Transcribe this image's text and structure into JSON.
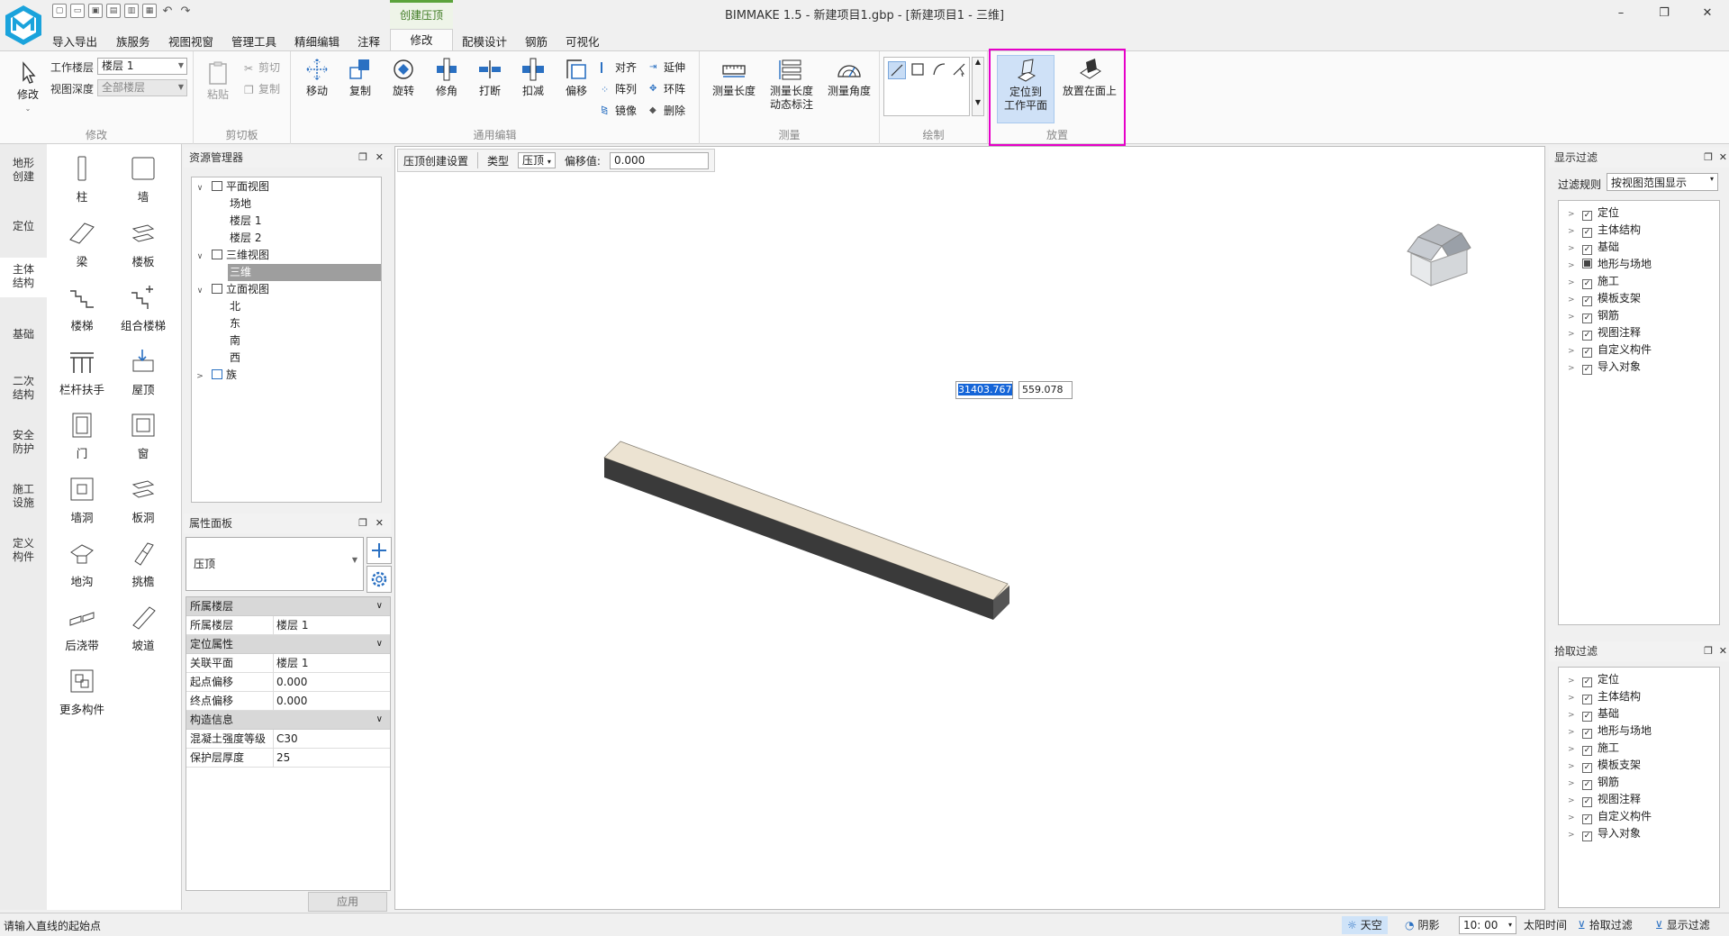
{
  "app": {
    "window_title": "BIMMAKE 1.5 - 新建项目1.gbp - [新建项目1 - 三维]",
    "context_tab": "创建压顶",
    "menu_tabs": [
      "导入导出",
      "族服务",
      "视图视窗",
      "管理工具",
      "精细编辑",
      "注释",
      "修改",
      "配模设计",
      "钢筋",
      "可视化"
    ],
    "win_min": "–",
    "win_restore": "❐",
    "win_close": "✕",
    "help": "?",
    "doc_min": "–",
    "doc_restore": "❐",
    "doc_close": "✕"
  },
  "ribbon": {
    "modify": {
      "label": "修改",
      "button": "修改",
      "floor_label": "工作楼层",
      "floor_value": "楼层 1",
      "depth_label": "视图深度",
      "depth_value": "全部楼层"
    },
    "clipboard": {
      "label": "剪切板",
      "paste": "粘贴",
      "cut": "剪切",
      "copy": "复制"
    },
    "edit": {
      "label": "通用编辑",
      "move": "移动",
      "copy": "复制",
      "rotate": "旋转",
      "trim": "修角",
      "break": "打断",
      "deduct": "扣减",
      "offset": "偏移",
      "align": "对齐",
      "array": "阵列",
      "mirror": "镜像",
      "extend": "延伸",
      "ring_array": "环阵",
      "delete": "删除"
    },
    "measure": {
      "label": "测量",
      "length": "测量长度",
      "dim_line1": "测量长度",
      "dim_line2": "动态标注",
      "angle": "测量角度"
    },
    "draw": {
      "label": "绘制"
    },
    "place": {
      "label": "放置",
      "on_plane_line1": "定位到",
      "on_plane_line2": "工作平面",
      "on_face": "放置在面上"
    }
  },
  "categories": [
    "地形创建",
    "定位",
    "主体结构",
    "基础",
    "二次结构",
    "安全防护",
    "施工设施",
    "定义构件"
  ],
  "active_category": "主体结构",
  "components": [
    "柱",
    "墙",
    "梁",
    "楼板",
    "楼梯",
    "组合楼梯",
    "栏杆扶手",
    "屋顶",
    "门",
    "窗",
    "墙洞",
    "板洞",
    "地沟",
    "挑檐",
    "后浇带",
    "坡道",
    "更多构件"
  ],
  "resource_manager": {
    "title": "资源管理器",
    "tree": [
      {
        "label": "平面视图",
        "level": 0,
        "toggle": "∨"
      },
      {
        "label": "场地",
        "level": 1
      },
      {
        "label": "楼层 1",
        "level": 1
      },
      {
        "label": "楼层 2",
        "level": 1
      },
      {
        "label": "三维视图",
        "level": 0,
        "toggle": "∨"
      },
      {
        "label": "三维",
        "level": 1,
        "selected": true
      },
      {
        "label": "立面视图",
        "level": 0,
        "toggle": "∨"
      },
      {
        "label": "北",
        "level": 1
      },
      {
        "label": "东",
        "level": 1
      },
      {
        "label": "南",
        "level": 1
      },
      {
        "label": "西",
        "level": 1
      },
      {
        "label": "族",
        "level": 0,
        "toggle": ">"
      }
    ]
  },
  "properties": {
    "title": "属性面板",
    "type_value": "压顶",
    "sections": [
      {
        "name": "所属楼层",
        "rows": [
          {
            "k": "所属楼层",
            "v": "楼层 1"
          }
        ]
      },
      {
        "name": "定位属性",
        "rows": [
          {
            "k": "关联平面",
            "v": "楼层 1"
          },
          {
            "k": "起点偏移",
            "v": "0.000"
          },
          {
            "k": "终点偏移",
            "v": "0.000"
          }
        ]
      },
      {
        "name": "构造信息",
        "rows": [
          {
            "k": "混凝土强度等级",
            "v": "C30"
          },
          {
            "k": "保护层厚度",
            "v": "25"
          }
        ]
      }
    ],
    "apply": "应用"
  },
  "viewport": {
    "settings_label": "压顶创建设置",
    "type_label": "类型",
    "type_value": "压顶",
    "offset_label": "偏移值:",
    "offset_value": "0.000",
    "coord_x": "31403.767",
    "coord_y": "559.078"
  },
  "display_filter": {
    "title": "显示过滤",
    "rule_label": "过滤规则",
    "rule_value": "按视图范围显示",
    "items": [
      "定位",
      "主体结构",
      "基础",
      "地形与场地",
      "施工",
      "模板支架",
      "钢筋",
      "视图注释",
      "自定义构件",
      "导入对象"
    ]
  },
  "pick_filter": {
    "title": "拾取过滤",
    "items": [
      "定位",
      "主体结构",
      "基础",
      "地形与场地",
      "施工",
      "模板支架",
      "钢筋",
      "视图注释",
      "自定义构件",
      "导入对象"
    ]
  },
  "status": {
    "prompt": "请输入直线的起始点",
    "sky": "天空",
    "shadow": "阴影",
    "time": "10: 00",
    "sun_time": "太阳时间",
    "pick_filter": "拾取过滤",
    "display_filter": "显示过滤"
  },
  "colors": {
    "accent_green": "#5ba33b",
    "highlight_magenta": "#e600c8",
    "selection_blue": "#1565d8",
    "beam_top": "#ece3d2",
    "beam_side": "#3a3a3a"
  }
}
